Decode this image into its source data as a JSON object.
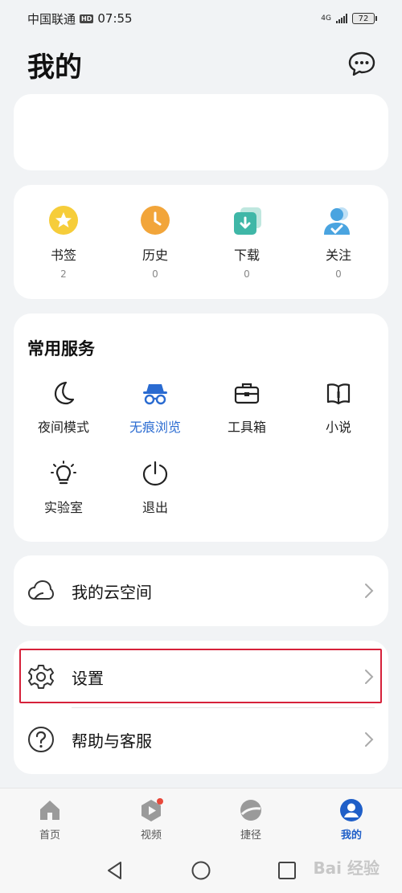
{
  "status_bar": {
    "carrier": "中国联通",
    "hd": "HD",
    "time": "07:55",
    "network": "4G",
    "battery": "72"
  },
  "header": {
    "title": "我的",
    "message_icon": "chat-bubble-icon"
  },
  "quick_links": [
    {
      "label": "书签",
      "count": "2",
      "icon": "star-icon",
      "color": "#f5c518"
    },
    {
      "label": "历史",
      "count": "0",
      "icon": "clock-icon",
      "color": "#f2a53a"
    },
    {
      "label": "下载",
      "count": "0",
      "icon": "download-icon",
      "color": "#3fb7a7"
    },
    {
      "label": "关注",
      "count": "0",
      "icon": "follow-user-icon",
      "color": "#4aa4e0"
    }
  ],
  "services": {
    "title": "常用服务",
    "items": [
      {
        "label": "夜间模式",
        "icon": "moon-icon"
      },
      {
        "label": "无痕浏览",
        "icon": "incognito-icon",
        "active": true
      },
      {
        "label": "工具箱",
        "icon": "toolbox-icon"
      },
      {
        "label": "小说",
        "icon": "book-icon"
      },
      {
        "label": "实验室",
        "icon": "lightbulb-icon"
      },
      {
        "label": "退出",
        "icon": "power-icon"
      }
    ]
  },
  "cloud": {
    "label": "我的云空间",
    "icon": "cloud-icon"
  },
  "settings_rows": [
    {
      "label": "设置",
      "icon": "gear-icon"
    },
    {
      "label": "帮助与客服",
      "icon": "help-icon"
    }
  ],
  "bottom_nav": [
    {
      "label": "首页",
      "icon": "home-icon"
    },
    {
      "label": "视频",
      "icon": "video-icon"
    },
    {
      "label": "捷径",
      "icon": "shortcut-icon"
    },
    {
      "label": "我的",
      "icon": "profile-icon",
      "active": true
    }
  ],
  "watermark": "Bai 经验",
  "colors": {
    "accent": "#1f5fc8",
    "highlight_border": "#d6213a",
    "background": "#f1f3f5"
  }
}
